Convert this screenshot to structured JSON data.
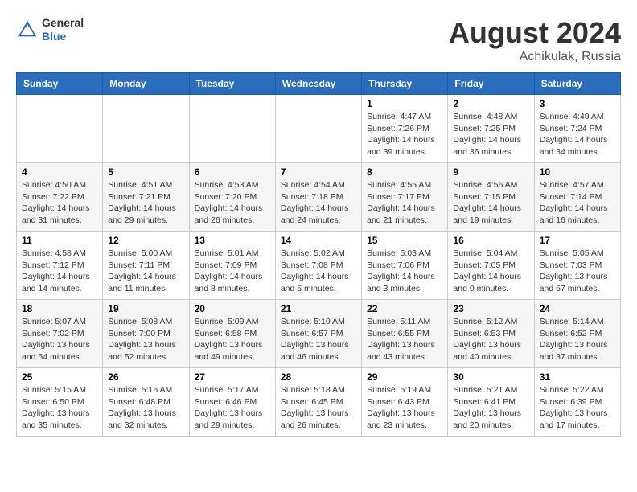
{
  "header": {
    "logo_general": "General",
    "logo_blue": "Blue",
    "title": "August 2024",
    "subtitle": "Achikulak, Russia"
  },
  "days_of_week": [
    "Sunday",
    "Monday",
    "Tuesday",
    "Wednesday",
    "Thursday",
    "Friday",
    "Saturday"
  ],
  "weeks": [
    [
      {
        "day": "",
        "info": ""
      },
      {
        "day": "",
        "info": ""
      },
      {
        "day": "",
        "info": ""
      },
      {
        "day": "",
        "info": ""
      },
      {
        "day": "1",
        "info": "Sunrise: 4:47 AM\nSunset: 7:26 PM\nDaylight: 14 hours\nand 39 minutes."
      },
      {
        "day": "2",
        "info": "Sunrise: 4:48 AM\nSunset: 7:25 PM\nDaylight: 14 hours\nand 36 minutes."
      },
      {
        "day": "3",
        "info": "Sunrise: 4:49 AM\nSunset: 7:24 PM\nDaylight: 14 hours\nand 34 minutes."
      }
    ],
    [
      {
        "day": "4",
        "info": "Sunrise: 4:50 AM\nSunset: 7:22 PM\nDaylight: 14 hours\nand 31 minutes."
      },
      {
        "day": "5",
        "info": "Sunrise: 4:51 AM\nSunset: 7:21 PM\nDaylight: 14 hours\nand 29 minutes."
      },
      {
        "day": "6",
        "info": "Sunrise: 4:53 AM\nSunset: 7:20 PM\nDaylight: 14 hours\nand 26 minutes."
      },
      {
        "day": "7",
        "info": "Sunrise: 4:54 AM\nSunset: 7:18 PM\nDaylight: 14 hours\nand 24 minutes."
      },
      {
        "day": "8",
        "info": "Sunrise: 4:55 AM\nSunset: 7:17 PM\nDaylight: 14 hours\nand 21 minutes."
      },
      {
        "day": "9",
        "info": "Sunrise: 4:56 AM\nSunset: 7:15 PM\nDaylight: 14 hours\nand 19 minutes."
      },
      {
        "day": "10",
        "info": "Sunrise: 4:57 AM\nSunset: 7:14 PM\nDaylight: 14 hours\nand 16 minutes."
      }
    ],
    [
      {
        "day": "11",
        "info": "Sunrise: 4:58 AM\nSunset: 7:12 PM\nDaylight: 14 hours\nand 14 minutes."
      },
      {
        "day": "12",
        "info": "Sunrise: 5:00 AM\nSunset: 7:11 PM\nDaylight: 14 hours\nand 11 minutes."
      },
      {
        "day": "13",
        "info": "Sunrise: 5:01 AM\nSunset: 7:09 PM\nDaylight: 14 hours\nand 8 minutes."
      },
      {
        "day": "14",
        "info": "Sunrise: 5:02 AM\nSunset: 7:08 PM\nDaylight: 14 hours\nand 5 minutes."
      },
      {
        "day": "15",
        "info": "Sunrise: 5:03 AM\nSunset: 7:06 PM\nDaylight: 14 hours\nand 3 minutes."
      },
      {
        "day": "16",
        "info": "Sunrise: 5:04 AM\nSunset: 7:05 PM\nDaylight: 14 hours\nand 0 minutes."
      },
      {
        "day": "17",
        "info": "Sunrise: 5:05 AM\nSunset: 7:03 PM\nDaylight: 13 hours\nand 57 minutes."
      }
    ],
    [
      {
        "day": "18",
        "info": "Sunrise: 5:07 AM\nSunset: 7:02 PM\nDaylight: 13 hours\nand 54 minutes."
      },
      {
        "day": "19",
        "info": "Sunrise: 5:08 AM\nSunset: 7:00 PM\nDaylight: 13 hours\nand 52 minutes."
      },
      {
        "day": "20",
        "info": "Sunrise: 5:09 AM\nSunset: 6:58 PM\nDaylight: 13 hours\nand 49 minutes."
      },
      {
        "day": "21",
        "info": "Sunrise: 5:10 AM\nSunset: 6:57 PM\nDaylight: 13 hours\nand 46 minutes."
      },
      {
        "day": "22",
        "info": "Sunrise: 5:11 AM\nSunset: 6:55 PM\nDaylight: 13 hours\nand 43 minutes."
      },
      {
        "day": "23",
        "info": "Sunrise: 5:12 AM\nSunset: 6:53 PM\nDaylight: 13 hours\nand 40 minutes."
      },
      {
        "day": "24",
        "info": "Sunrise: 5:14 AM\nSunset: 6:52 PM\nDaylight: 13 hours\nand 37 minutes."
      }
    ],
    [
      {
        "day": "25",
        "info": "Sunrise: 5:15 AM\nSunset: 6:50 PM\nDaylight: 13 hours\nand 35 minutes."
      },
      {
        "day": "26",
        "info": "Sunrise: 5:16 AM\nSunset: 6:48 PM\nDaylight: 13 hours\nand 32 minutes."
      },
      {
        "day": "27",
        "info": "Sunrise: 5:17 AM\nSunset: 6:46 PM\nDaylight: 13 hours\nand 29 minutes."
      },
      {
        "day": "28",
        "info": "Sunrise: 5:18 AM\nSunset: 6:45 PM\nDaylight: 13 hours\nand 26 minutes."
      },
      {
        "day": "29",
        "info": "Sunrise: 5:19 AM\nSunset: 6:43 PM\nDaylight: 13 hours\nand 23 minutes."
      },
      {
        "day": "30",
        "info": "Sunrise: 5:21 AM\nSunset: 6:41 PM\nDaylight: 13 hours\nand 20 minutes."
      },
      {
        "day": "31",
        "info": "Sunrise: 5:22 AM\nSunset: 6:39 PM\nDaylight: 13 hours\nand 17 minutes."
      }
    ]
  ]
}
